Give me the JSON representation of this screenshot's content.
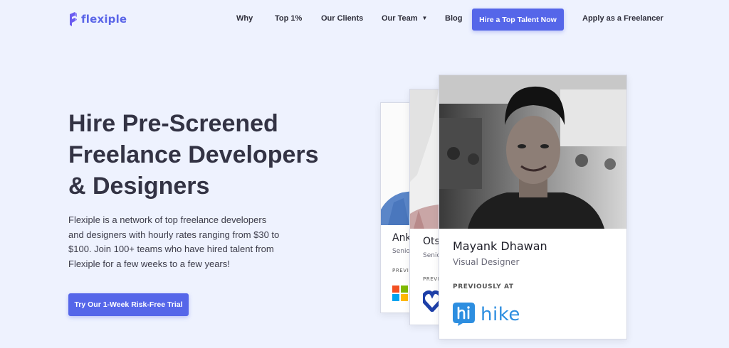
{
  "brand": {
    "name": "flexiple",
    "color": "#5b66e8"
  },
  "nav": {
    "links": [
      "Why",
      "Top 1%",
      "Our Clients",
      "Our Team",
      "Blog"
    ],
    "team_caret_icon": "caret-down-icon",
    "cta": "Hire a Top Talent Now",
    "freelancer_link": "Apply as a Freelancer"
  },
  "hero": {
    "headline": "Hire Pre-Screened Freelance Developers & Designers",
    "description": "Flexiple is a network of top freelance developers and designers with hourly rates ranging from $30 to $100. Join 100+ teams who have hired talent from Flexiple for a few weeks to a few years!",
    "cta": "Try Our 1-Week Risk-Free Trial",
    "accent": "#5566e9"
  },
  "cards": {
    "back1": {
      "name": "Anku",
      "role": "Senio",
      "previously": "PREVI",
      "company_icon": "microsoft-logo-icon"
    },
    "back2": {
      "name": "Ots",
      "role": "Senio",
      "previously": "PREVI",
      "company_icon": "heart-logo-icon"
    },
    "front": {
      "name": "Mayank Dhawan",
      "role": "Visual Designer",
      "previously": "PREVIOUSLY AT",
      "company": "hike",
      "company_color": "#2d8ee0"
    }
  }
}
